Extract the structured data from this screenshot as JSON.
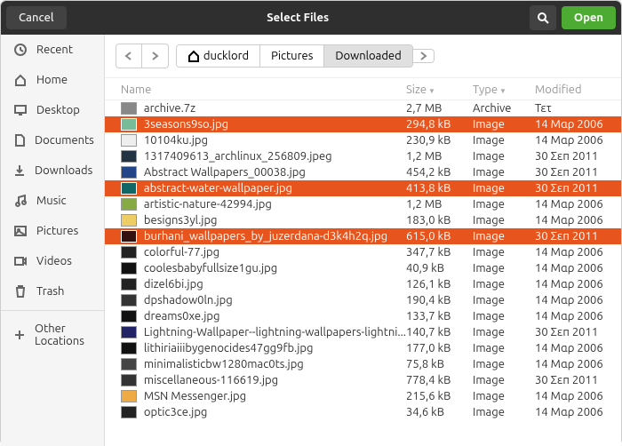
{
  "header": {
    "cancel": "Cancel",
    "title": "Select Files",
    "open": "Open"
  },
  "sidebar": {
    "items": [
      {
        "icon": "clock",
        "label": "Recent"
      },
      {
        "icon": "home",
        "label": "Home"
      },
      {
        "icon": "desktop",
        "label": "Desktop"
      },
      {
        "icon": "doc",
        "label": "Documents"
      },
      {
        "icon": "download",
        "label": "Downloads"
      },
      {
        "icon": "music",
        "label": "Music"
      },
      {
        "icon": "picture",
        "label": "Pictures"
      },
      {
        "icon": "video",
        "label": "Videos"
      },
      {
        "icon": "trash",
        "label": "Trash"
      }
    ],
    "other": {
      "icon": "plus",
      "label": "Other Locations"
    }
  },
  "breadcrumb": [
    "ducklord",
    "Pictures",
    "Downloaded"
  ],
  "columns": {
    "name": "Name",
    "size": "Size",
    "type": "Type",
    "modified": "Modified"
  },
  "files": [
    {
      "name": "archive.7z",
      "size": "2,7 MB",
      "type": "Archive",
      "modified": "Τετ",
      "sel": false,
      "thumb": "#888"
    },
    {
      "name": "3seasons9so.jpg",
      "size": "294,8 kB",
      "type": "Image",
      "modified": "14 Μαρ 2006",
      "sel": true,
      "thumb": "#7b9"
    },
    {
      "name": "10104ku.jpg",
      "size": "230,9 kB",
      "type": "Image",
      "modified": "14 Μαρ 2006",
      "sel": false,
      "thumb": "#eee"
    },
    {
      "name": "1317409613_archlinux_256809.jpeg",
      "size": "1,2 MB",
      "type": "Image",
      "modified": "30 Σεπ 2011",
      "sel": false,
      "thumb": "#234"
    },
    {
      "name": "Abstract Wallpapers_00038.jpg",
      "size": "454,2 kB",
      "type": "Image",
      "modified": "30 Σεπ 2011",
      "sel": false,
      "thumb": "#248"
    },
    {
      "name": "abstract-water-wallpaper.jpg",
      "size": "413,8 kB",
      "type": "Image",
      "modified": "30 Σεπ 2011",
      "sel": true,
      "thumb": "#166"
    },
    {
      "name": "artistic-nature-42994.jpg",
      "size": "1,2 MB",
      "type": "Image",
      "modified": "14 Μαρ 2006",
      "sel": false,
      "thumb": "#8a4"
    },
    {
      "name": "besigns3yl.jpg",
      "size": "183,0 kB",
      "type": "Image",
      "modified": "14 Μαρ 2006",
      "sel": false,
      "thumb": "#ec6"
    },
    {
      "name": "burhani_wallpapers_by_juzerdana-d3k4h2q.jpg",
      "size": "615,0 kB",
      "type": "Image",
      "modified": "30 Σεπ 2011",
      "sel": true,
      "thumb": "#311"
    },
    {
      "name": "colorful-77.jpg",
      "size": "347,7 kB",
      "type": "Image",
      "modified": "14 Μαρ 2006",
      "sel": false,
      "thumb": "#222"
    },
    {
      "name": "coolesbabyfullsize1gu.jpg",
      "size": "40,9 kB",
      "type": "Image",
      "modified": "14 Μαρ 2006",
      "sel": false,
      "thumb": "#111"
    },
    {
      "name": "dizel6bi.jpg",
      "size": "126,1 kB",
      "type": "Image",
      "modified": "14 Μαρ 2006",
      "sel": false,
      "thumb": "#222"
    },
    {
      "name": "dpshadow0ln.jpg",
      "size": "190,4 kB",
      "type": "Image",
      "modified": "14 Μαρ 2006",
      "sel": false,
      "thumb": "#333"
    },
    {
      "name": "dreams0xe.jpg",
      "size": "133,7 kB",
      "type": "Image",
      "modified": "14 Μαρ 2006",
      "sel": false,
      "thumb": "#111"
    },
    {
      "name": "Lightning-Wallpaper--lightning-wallpapers-lightni...",
      "size": "140,7 kB",
      "type": "Image",
      "modified": "30 Σεπ 2011",
      "sel": false,
      "thumb": "#226"
    },
    {
      "name": "lithiriaiiibygenocides47gg9fb.jpg",
      "size": "177,0 kB",
      "type": "Image",
      "modified": "14 Μαρ 2006",
      "sel": false,
      "thumb": "#111"
    },
    {
      "name": "minimalisticbw1280mac0ts.jpg",
      "size": "75,8 kB",
      "type": "Image",
      "modified": "14 Μαρ 2006",
      "sel": false,
      "thumb": "#444"
    },
    {
      "name": "miscellaneous-116619.jpg",
      "size": "778,4 kB",
      "type": "Image",
      "modified": "30 Σεπ 2011",
      "sel": false,
      "thumb": "#333"
    },
    {
      "name": "MSN Messenger.jpg",
      "size": "215,6 kB",
      "type": "Image",
      "modified": "14 Μαρ 2006",
      "sel": false,
      "thumb": "#ea4"
    },
    {
      "name": "optic3ce.jpg",
      "size": "34,6 kB",
      "type": "Image",
      "modified": "14 Μαρ 2006",
      "sel": false,
      "thumb": "#222"
    }
  ]
}
